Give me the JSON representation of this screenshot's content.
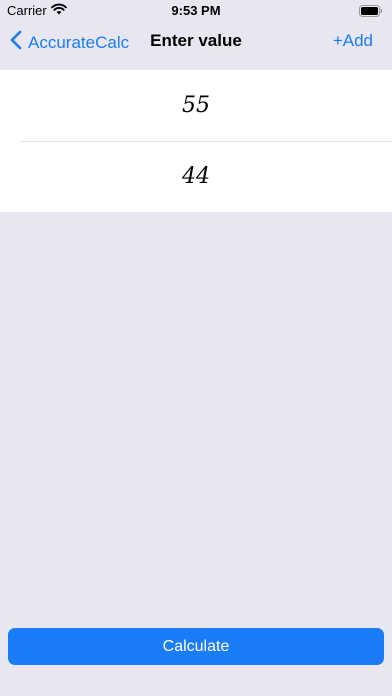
{
  "status_bar": {
    "carrier": "Carrier",
    "time": "9:53 PM"
  },
  "nav": {
    "back_label": "AccurateCalc",
    "title": "Enter value",
    "add_label": "+Add"
  },
  "values": [
    "55",
    "44"
  ],
  "calculate_label": "Calculate",
  "colors": {
    "accent": "#1a7cf6",
    "background": "#e8e7f1",
    "row_background": "#ffffff"
  },
  "icons": [
    "wifi-icon",
    "battery-icon",
    "chevron-left-icon"
  ]
}
